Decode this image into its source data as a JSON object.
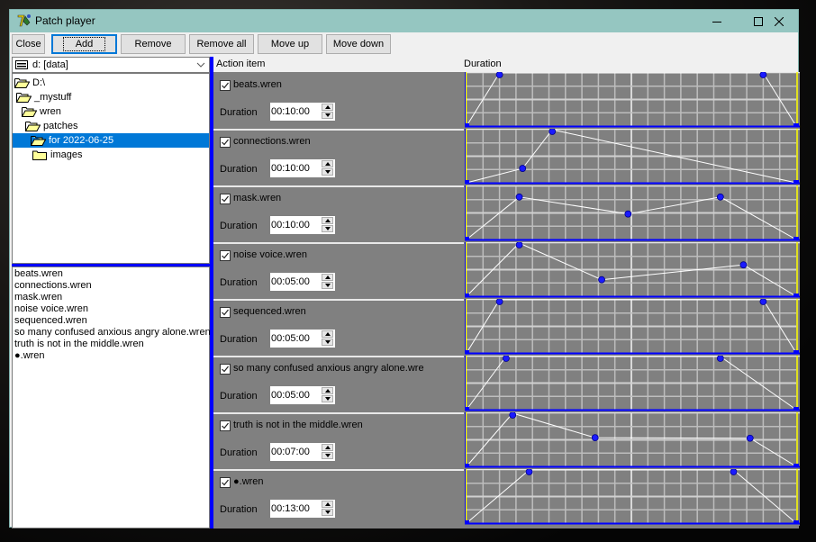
{
  "window": {
    "title": "Patch player",
    "controls": [
      "minimize",
      "maximize",
      "close"
    ]
  },
  "toolbar": {
    "buttons": [
      {
        "label": "Close"
      },
      {
        "label": "Add",
        "focused": true
      },
      {
        "label": "Remove"
      },
      {
        "label": "Remove all"
      },
      {
        "label": "Move up"
      },
      {
        "label": "Move down"
      }
    ]
  },
  "drive": {
    "label": "d: [data]",
    "icon": "drive-icon"
  },
  "tree": {
    "items": [
      {
        "label": "D:\\",
        "level": 0,
        "icon": "open-folder-icon"
      },
      {
        "label": "_mystuff",
        "level": 1,
        "icon": "open-folder-icon"
      },
      {
        "label": "wren",
        "level": 2,
        "icon": "open-folder-icon"
      },
      {
        "label": "patches",
        "level": 3,
        "icon": "open-folder-icon"
      },
      {
        "label": "for 2022-06-25",
        "level": 4,
        "icon": "open-folder-icon",
        "selected": true
      },
      {
        "label": "images",
        "level": 5,
        "icon": "closed-folder-icon"
      }
    ]
  },
  "files": [
    "beats.wren",
    "connections.wren",
    "mask.wren",
    "noise voice.wren",
    "sequenced.wren",
    "so many confused anxious angry alone.wren",
    "truth is not in the middle.wren",
    "●.wren"
  ],
  "columns": {
    "action": "Action item",
    "duration": "Duration"
  },
  "colors": {
    "accent": "#0000ff",
    "selection": "#0078d7",
    "titlebar": "#95c6c1",
    "panel": "#808080",
    "envelope_line": "#ffffff",
    "envelope_point": "#0000ff",
    "envelope_edge": "#ffff00"
  },
  "duration_label": "Duration",
  "items": [
    {
      "name": "beats.wren",
      "checked": true,
      "duration": "00:10:00",
      "envelope": [
        [
          0,
          0
        ],
        [
          0.1,
          1
        ],
        [
          0.9,
          1
        ],
        [
          1,
          0
        ]
      ]
    },
    {
      "name": "connections.wren",
      "checked": true,
      "duration": "00:10:00",
      "envelope": [
        [
          0,
          0
        ],
        [
          0.17,
          0.27
        ],
        [
          0.26,
          1
        ],
        [
          1,
          0
        ]
      ]
    },
    {
      "name": "mask.wren",
      "checked": true,
      "duration": "00:10:00",
      "envelope": [
        [
          0,
          0
        ],
        [
          0.16,
          0.8
        ],
        [
          0.49,
          0.48
        ],
        [
          0.77,
          0.8
        ],
        [
          1,
          0
        ]
      ]
    },
    {
      "name": "noise voice.wren",
      "checked": true,
      "duration": "00:05:00",
      "envelope": [
        [
          0,
          0
        ],
        [
          0.16,
          1
        ],
        [
          0.41,
          0.31
        ],
        [
          0.84,
          0.59
        ],
        [
          1,
          0
        ]
      ]
    },
    {
      "name": "sequenced.wren",
      "checked": true,
      "duration": "00:05:00",
      "envelope": [
        [
          0,
          0
        ],
        [
          0.1,
          1
        ],
        [
          0.9,
          1
        ],
        [
          1,
          0
        ]
      ]
    },
    {
      "name": "so many confused anxious angry alone.wre",
      "checked": true,
      "duration": "00:05:00",
      "envelope": [
        [
          0,
          0
        ],
        [
          0.12,
          1
        ],
        [
          0.77,
          1
        ],
        [
          1,
          0
        ]
      ]
    },
    {
      "name": "truth is not in the middle.wren",
      "checked": true,
      "duration": "00:07:00",
      "envelope": [
        [
          0,
          0
        ],
        [
          0.14,
          1
        ],
        [
          0.39,
          0.54
        ],
        [
          0.86,
          0.53
        ],
        [
          1,
          0
        ]
      ]
    },
    {
      "name": "●.wren",
      "checked": true,
      "duration": "00:13:00",
      "envelope": [
        [
          0,
          0
        ],
        [
          0.19,
          1
        ],
        [
          0.81,
          1
        ],
        [
          1,
          0
        ]
      ]
    }
  ]
}
